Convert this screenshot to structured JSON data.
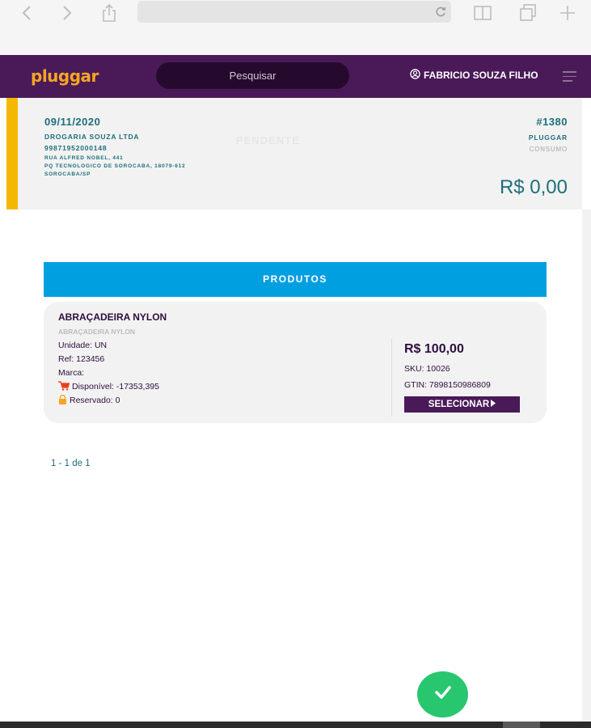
{
  "browser": {
    "icons": [
      "back-icon",
      "forward-icon",
      "share-icon",
      "reload-icon",
      "book-icon",
      "tabs-icon",
      "new-tab-icon"
    ]
  },
  "header": {
    "logo": "pluggar",
    "search_placeholder": "Pesquisar",
    "user_name": "FABRICIO SOUZA FILHO"
  },
  "order": {
    "date": "09/11/2020",
    "client_name": "DROGARIA SOUZA LTDA",
    "cnpj": "99871952000148",
    "address_line1": "RUA ALFRED NOBEL, 441",
    "address_line2": "PQ TECNOLOGICO DE SOROCABA, 18079-612",
    "address_line3": "SOROCABA/SP",
    "status": "PENDENTE",
    "number": "#1380",
    "company": "PLUGGAR",
    "type": "CONSUMO",
    "total": "R$ 0,00"
  },
  "products": {
    "header": "PRODUTOS",
    "items": [
      {
        "name": "ABRAÇADEIRA NYLON",
        "subtitle": "ABRAÇADEIRA NYLON",
        "unit": "Unidade: UN",
        "ref": "Ref: 123456",
        "brand": "Marca:",
        "available": "Disponível: -17353,395",
        "reserved": "Reservado: 0",
        "price": "R$ 100,00",
        "sku": "SKU: 10026",
        "gtin": "GTIN: 7898150986809",
        "select_label": "SELECIONAR"
      }
    ]
  },
  "pagination": "1 - 1 de 1",
  "colors": {
    "header_bg": "#4a1a58",
    "logo": "#f5a623",
    "accent_stripe": "#f5b800",
    "teal_text": "#1d6f7a",
    "products_header": "#009fe0",
    "confirm_button": "#28c76f"
  }
}
